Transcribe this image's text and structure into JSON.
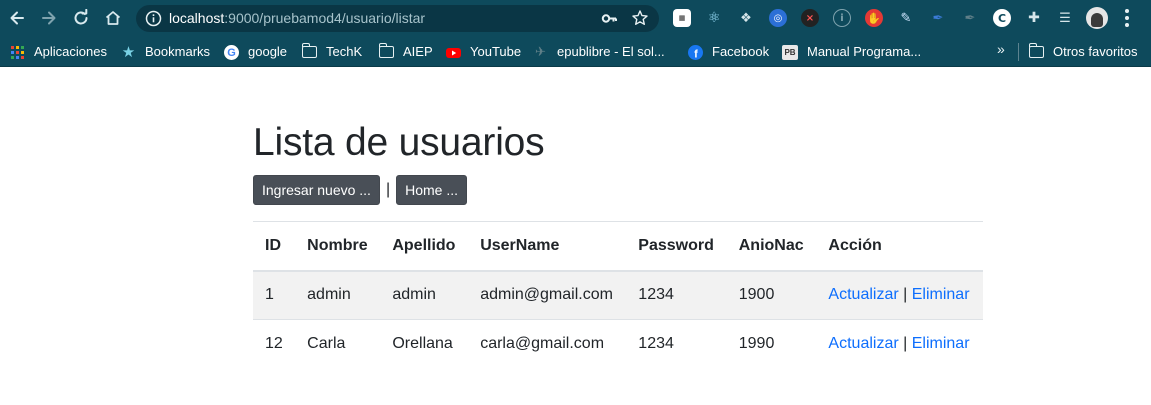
{
  "browser": {
    "url_host": "localhost",
    "url_rest": ":9000/pruebamod4/usuario/listar",
    "bookmarks": [
      {
        "label": "Aplicaciones",
        "icon": "apps-grid-icon"
      },
      {
        "label": "Bookmarks",
        "icon": "star-icon"
      },
      {
        "label": "google",
        "icon": "google-icon"
      },
      {
        "label": "TechK",
        "icon": "folder-icon"
      },
      {
        "label": "AIEP",
        "icon": "folder-icon"
      },
      {
        "label": "YouTube",
        "icon": "youtube-icon"
      },
      {
        "label": "epublibre - El sol...",
        "icon": "epublibre-icon"
      },
      {
        "label": "Facebook",
        "icon": "facebook-icon"
      },
      {
        "label": "Manual Programa...",
        "icon": "pb-icon"
      }
    ],
    "bookmarks_overflow": "»",
    "other_bookmarks": "Otros favoritos",
    "colors": {
      "chrome": "#0e4a5c",
      "omnibox": "#0a3645"
    }
  },
  "page": {
    "title": "Lista de usuarios",
    "buttons": {
      "new": "Ingresar nuevo ...",
      "separator": "|",
      "home": "Home ..."
    },
    "table": {
      "headers": [
        "ID",
        "Nombre",
        "Apellido",
        "UserName",
        "Password",
        "AnioNac",
        "Acción"
      ],
      "rows": [
        [
          "1",
          "admin",
          "admin",
          "admin@gmail.com",
          "1234",
          "1900"
        ],
        [
          "12",
          "Carla",
          "Orellana",
          "carla@gmail.com",
          "1234",
          "1990"
        ]
      ],
      "actions": {
        "update": "Actualizar",
        "separator": "|",
        "delete": "Eliminar"
      }
    },
    "colors": {
      "button": "#494f57",
      "link": "#0d6efd",
      "stripe": "#f2f2f2"
    }
  }
}
